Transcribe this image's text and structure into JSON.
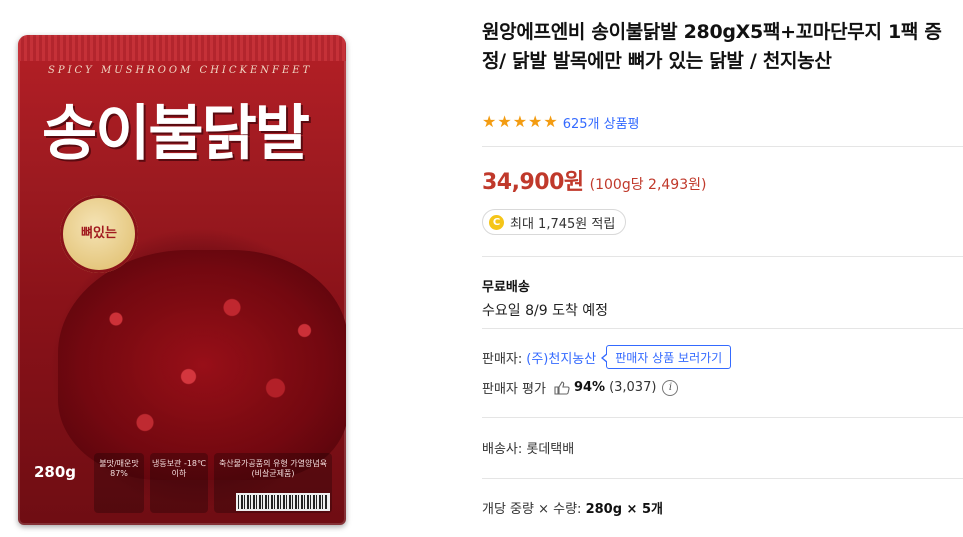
{
  "product_image": {
    "subtitle": "SPICY MUSHROOM CHICKENFEET",
    "brand": "송이불닭발",
    "sticker": "뼈있는",
    "weight": "280g",
    "info_a": "불맛/매운맛 87%",
    "info_b": "냉동보관 -18℃이하",
    "info_c": "축산물가공품의 유형 가열양념육(비살균제품)"
  },
  "product": {
    "title": "원앙에프엔비 송이불닭발 280gX5팩+꼬마단무지 1팩 증정/ 닭발 발목에만 뼈가 있는 닭발 / 천지농산",
    "rating_stars": 5,
    "review_count": "625개 상품평"
  },
  "price": {
    "amount": "34,900원",
    "unit_price": "(100g당 2,493원)"
  },
  "reward": {
    "coin_label": "C",
    "text": "최대 1,745원 적립"
  },
  "shipping": {
    "title": "무료배송",
    "eta": "수요일 8/9 도착 예정"
  },
  "seller": {
    "label": "판매자:",
    "name": "(주)천지농산",
    "goto_button": "판매자 상품 보러가기",
    "rating_label": "판매자 평가",
    "rating_pct": "94%",
    "rating_count": "(3,037)",
    "info_icon": "i"
  },
  "carrier": {
    "text": "배송사: 롯데택배"
  },
  "spec": {
    "label": "개당 중량 × 수량:",
    "value": "280g × 5개"
  },
  "colors": {
    "price": "#c0392b",
    "link": "#346aff",
    "star": "#f39c12",
    "coin": "#f5c518"
  }
}
